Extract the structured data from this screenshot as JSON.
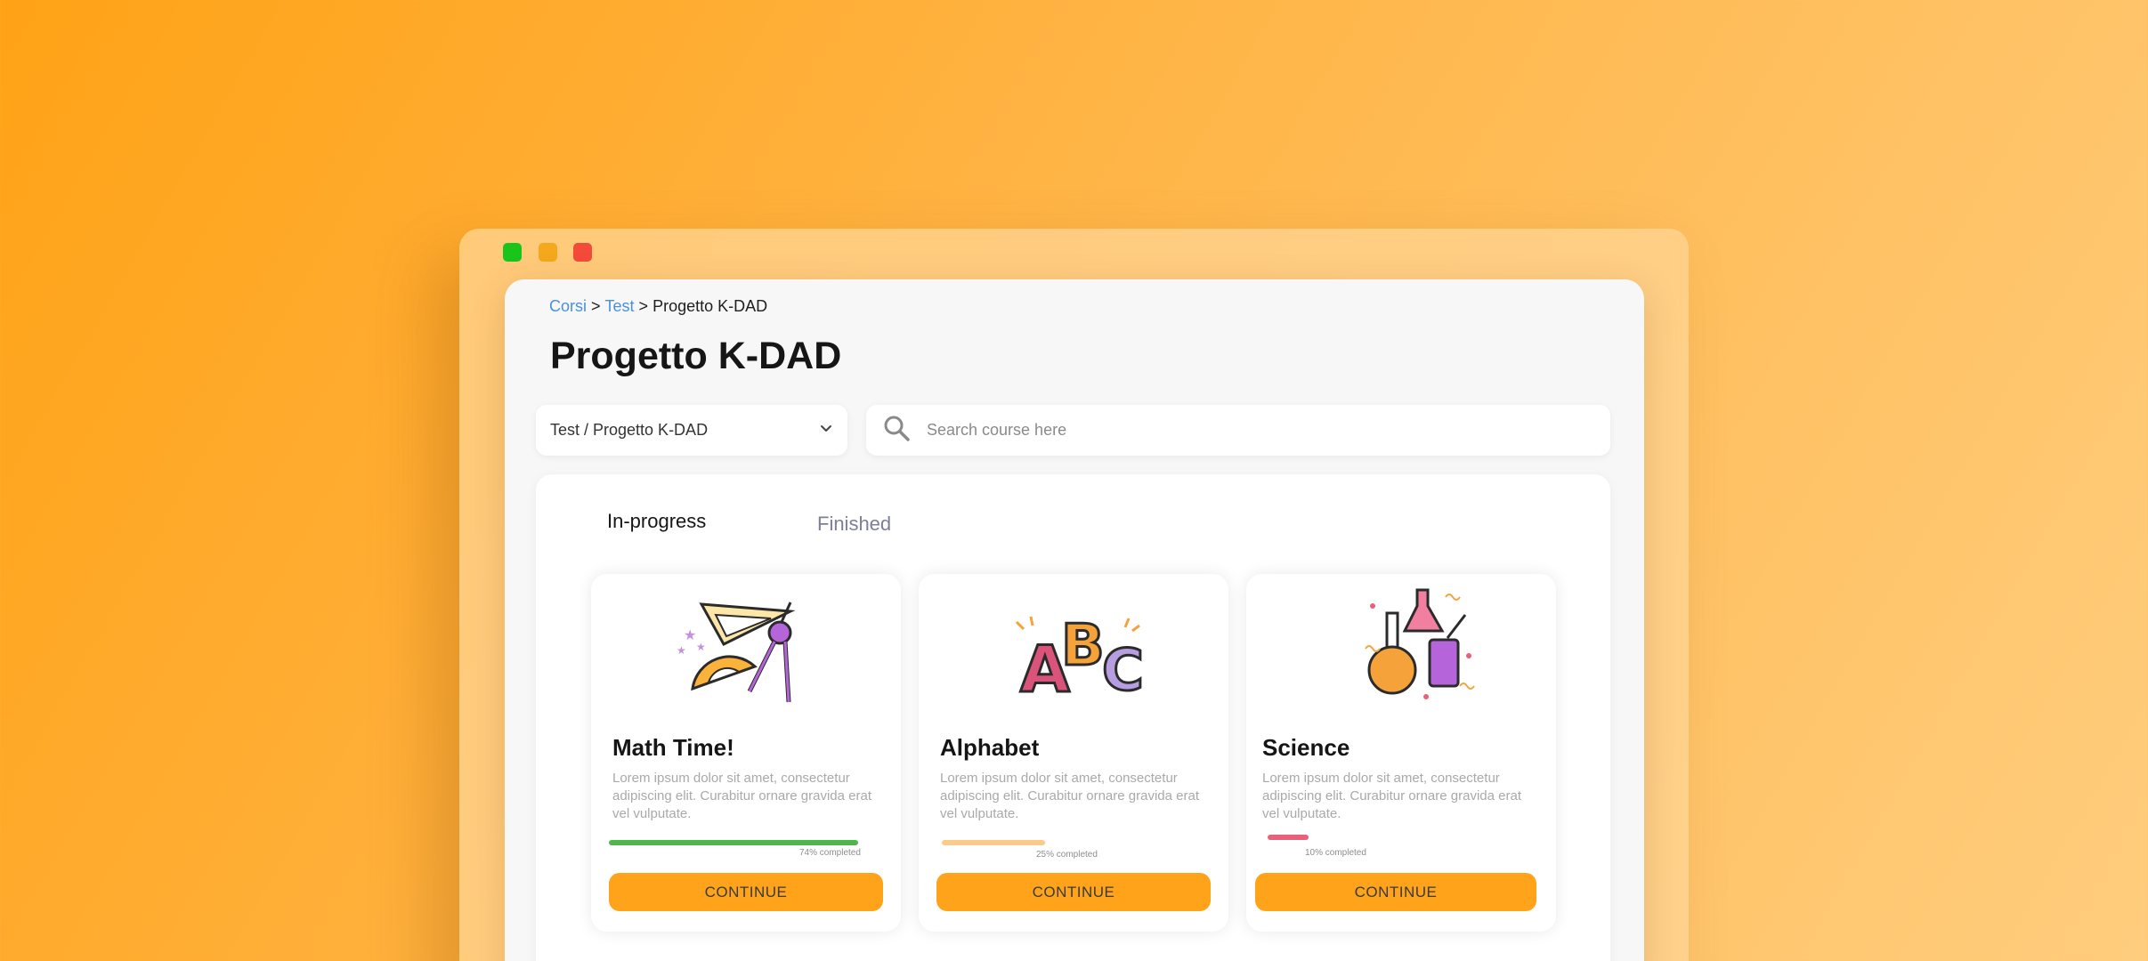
{
  "window": {
    "controls": [
      "green",
      "yellow",
      "red"
    ]
  },
  "breadcrumb": {
    "items": [
      "Corsi",
      "Test",
      "Progetto K-DAD"
    ],
    "separator": ">"
  },
  "page_title": "Progetto K-DAD",
  "course_select": {
    "value": "Test / Progetto K-DAD",
    "icon": "chevron-down-icon"
  },
  "search": {
    "placeholder": "Search course here",
    "icon": "search-icon"
  },
  "tabs": [
    {
      "label": "In-progress",
      "active": true
    },
    {
      "label": "Finished",
      "active": false
    }
  ],
  "courses": [
    {
      "title": "Math Time!",
      "description": "Lorem ipsum dolor sit amet, consectetur adipiscing elit. Curabitur ornare gravida erat vel vulputate.",
      "progress": 0.74,
      "progress_label": "74% completed",
      "progress_color": "#4cb84c",
      "illustration": "geometry-tools-illustration",
      "button_label": "CONTINUE"
    },
    {
      "title": "Alphabet",
      "description": "Lorem ipsum dolor sit amet, consectetur adipiscing elit. Curabitur ornare gravida erat vel vulputate.",
      "progress": 0.25,
      "progress_label": "25% completed",
      "progress_color": "#fccb88",
      "illustration": "abc-letters-illustration",
      "button_label": "CONTINUE"
    },
    {
      "title": "Science",
      "description": "Lorem ipsum dolor sit amet, consectetur adipiscing elit. Curabitur ornare gravida erat vel vulputate.",
      "progress": 0.1,
      "progress_label": "10% completed",
      "progress_color": "#e8607a",
      "illustration": "science-flasks-illustration",
      "button_label": "CONTINUE"
    }
  ],
  "colors": {
    "accent": "#ffa31a",
    "link": "#4a8fe0"
  }
}
